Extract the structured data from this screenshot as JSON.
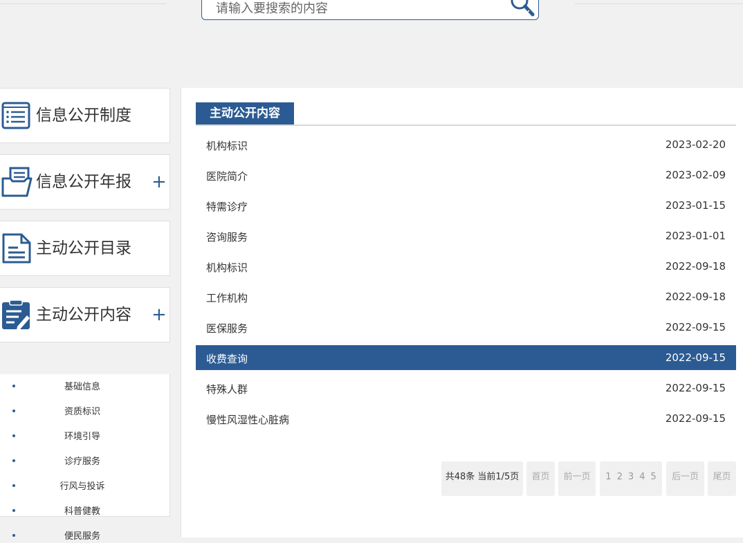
{
  "search": {
    "placeholder": "请输入要搜索的内容"
  },
  "sidebar": {
    "cards": [
      {
        "label": "信息公开制度",
        "icon": "list-book-icon",
        "expandable": false
      },
      {
        "label": "信息公开年报",
        "icon": "folder-document-icon",
        "expandable": true
      },
      {
        "label": "主动公开目录",
        "icon": "document-icon",
        "expandable": false
      },
      {
        "label": "主动公开内容",
        "icon": "clipboard-edit-icon",
        "expandable": true
      }
    ],
    "plus": "+",
    "sub_items": [
      "基础信息",
      "资质标识",
      "环境引导",
      "诊疗服务",
      "行风与投诉",
      "科普健教",
      "便民服务"
    ]
  },
  "main": {
    "section_title": "主动公开内容",
    "rows": [
      {
        "title": "机构标识",
        "date": "2023-02-20"
      },
      {
        "title": "医院简介",
        "date": "2023-02-09"
      },
      {
        "title": "特需诊疗",
        "date": "2023-01-15"
      },
      {
        "title": "咨询服务",
        "date": "2023-01-01"
      },
      {
        "title": "机构标识",
        "date": "2022-09-18"
      },
      {
        "title": "工作机构",
        "date": "2022-09-18"
      },
      {
        "title": "医保服务",
        "date": "2022-09-15"
      },
      {
        "title": "收费查询",
        "date": "2022-09-15",
        "active": true
      },
      {
        "title": "特殊人群",
        "date": "2022-09-15"
      },
      {
        "title": "慢性风湿性心脏病",
        "date": "2022-09-15"
      }
    ]
  },
  "pagination": {
    "info": "共48条 当前1/5页",
    "first": "首页",
    "prev": "前一页",
    "pages": [
      "1",
      "2",
      "3",
      "4",
      "5"
    ],
    "next": "后一页",
    "last": "尾页"
  },
  "colors": {
    "accent": "#2c5b93",
    "background": "#f1f1f1"
  }
}
